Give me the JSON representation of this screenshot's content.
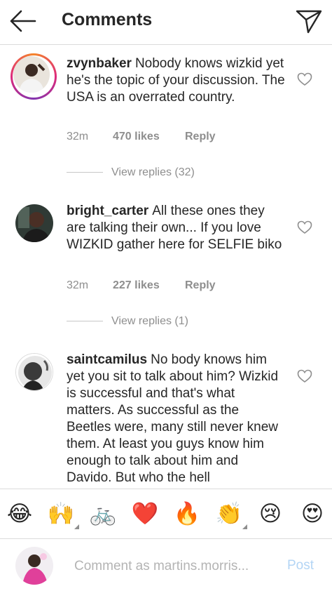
{
  "header": {
    "title": "Comments",
    "back_icon": "arrow-left-icon",
    "send_icon": "paper-plane-icon"
  },
  "comments": [
    {
      "username": "zvynbaker",
      "text": "Nobody knows wizkid yet he's the topic of your discussion. The USA is an overrated country.",
      "time": "32m",
      "likes": "470 likes",
      "reply": "Reply",
      "view_replies": "View replies (32)",
      "has_story_ring": true
    },
    {
      "username": "bright_carter",
      "text": "All these ones they are talking their own... If you love WIZKID gather here for SELFIE biko",
      "time": "32m",
      "likes": "227 likes",
      "reply": "Reply",
      "view_replies": "View replies (1)",
      "has_story_ring": false
    },
    {
      "username": "saintcamilus",
      "text": "No body knows him yet you sit to talk about him? Wizkid is successful and that's what matters. As successful as the Beetles were, many still never knew them. At least you guys know him enough to talk about him and Davido. But who the hell",
      "has_story_ring": false
    }
  ],
  "emoji_bar": [
    {
      "name": "laughing-tears-emoji",
      "glyph": "😂"
    },
    {
      "name": "raised-hands-emoji",
      "glyph": "🙌"
    },
    {
      "name": "bicycle-emoji",
      "glyph": "🚲"
    },
    {
      "name": "red-heart-emoji",
      "glyph": "❤️"
    },
    {
      "name": "fire-emoji",
      "glyph": "🔥"
    },
    {
      "name": "clapping-hands-emoji",
      "glyph": "👏"
    },
    {
      "name": "crying-face-emoji",
      "glyph": "😢"
    },
    {
      "name": "heart-eyes-emoji",
      "glyph": "😍"
    }
  ],
  "composer": {
    "placeholder": "Comment as martins.morris...",
    "value": "",
    "post_label": "Post"
  },
  "colors": {
    "text": "#262626",
    "secondary": "#8e8e8e",
    "divider": "#dbdbdb",
    "post_disabled": "#b3d5f5"
  }
}
